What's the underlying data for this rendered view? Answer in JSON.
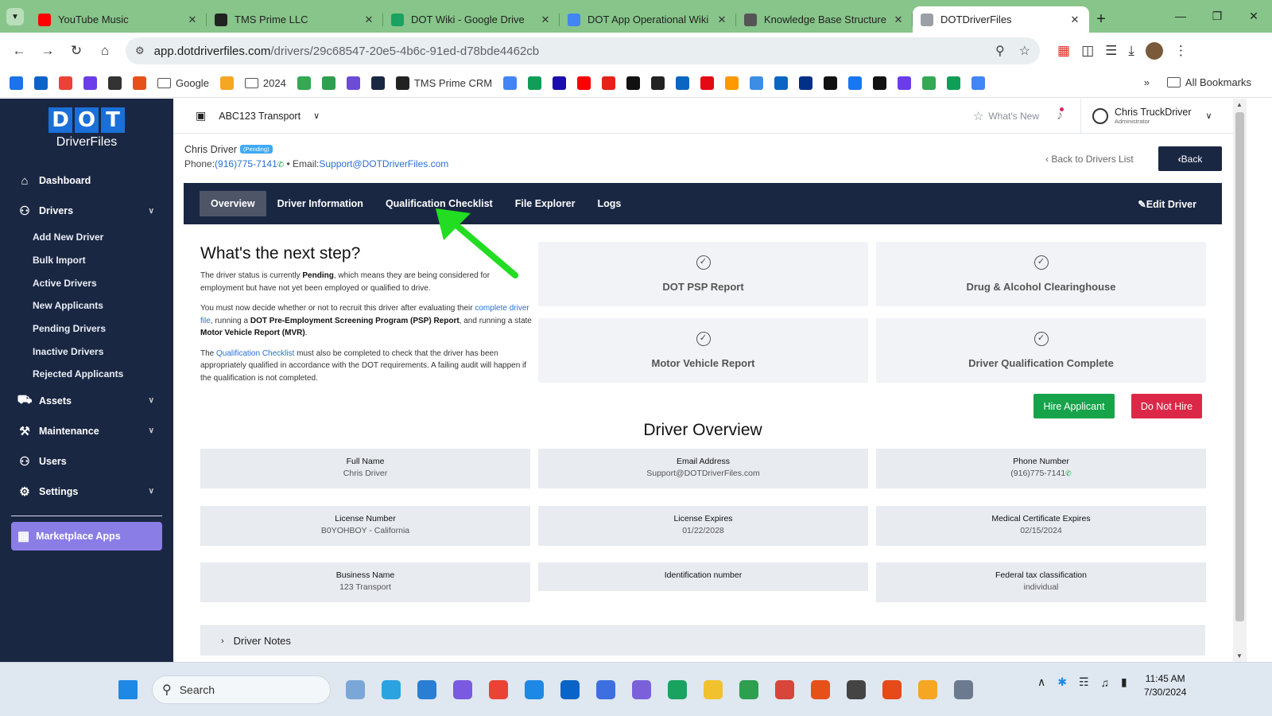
{
  "browser": {
    "tabs": [
      {
        "title": "YouTube Music",
        "color": "#ff0000"
      },
      {
        "title": "TMS Prime LLC",
        "color": "#222222"
      },
      {
        "title": "DOT Wiki - Google Drive",
        "color": "#1aa260"
      },
      {
        "title": "DOT App Operational Wiki",
        "color": "#4285f4"
      },
      {
        "title": "Knowledge Base Structure",
        "color": "#555555"
      },
      {
        "title": "DOTDriverFiles",
        "color": "#9aa0a6"
      }
    ],
    "url_host": "app.dotdriverfiles.com",
    "url_path": "/drivers/29c68547-20e5-4b6c-91ed-d78bde4462cb",
    "bookmarks": [
      {
        "label": "",
        "color": "#1a73e8"
      },
      {
        "label": "",
        "color": "#0a64c8"
      },
      {
        "label": "",
        "color": "#ea4335"
      },
      {
        "label": "",
        "color": "#6a3de8"
      },
      {
        "label": "",
        "color": "#333333"
      },
      {
        "label": "",
        "color": "#e8501a"
      },
      {
        "label": "Google",
        "folder": true
      },
      {
        "label": "",
        "color": "#f5a623"
      },
      {
        "label": "2024",
        "folder": true
      },
      {
        "label": "",
        "color": "#34a853"
      },
      {
        "label": "",
        "color": "#2e9e4f"
      },
      {
        "label": "",
        "color": "#6c4bd8"
      },
      {
        "label": "",
        "color": "#1a2743"
      },
      {
        "label": "TMS Prime CRM",
        "color": "#222222"
      },
      {
        "label": "",
        "color": "#4285f4"
      },
      {
        "label": "",
        "color": "#0f9d58"
      },
      {
        "label": "",
        "color": "#1a0dab"
      },
      {
        "label": "",
        "color": "#ff0000"
      },
      {
        "label": "",
        "color": "#e62117"
      },
      {
        "label": "",
        "color": "#111111"
      },
      {
        "label": "",
        "color": "#222222"
      },
      {
        "label": "",
        "color": "#0a66c2"
      },
      {
        "label": "",
        "color": "#e50914"
      },
      {
        "label": "",
        "color": "#ff9900"
      },
      {
        "label": "",
        "color": "#3d8de6"
      },
      {
        "label": "",
        "color": "#0a66c2"
      },
      {
        "label": "",
        "color": "#003087"
      },
      {
        "label": "",
        "color": "#111111"
      },
      {
        "label": "",
        "color": "#1877f2"
      },
      {
        "label": "",
        "color": "#111111"
      },
      {
        "label": "",
        "color": "#6a3de8"
      },
      {
        "label": "",
        "color": "#34a853"
      },
      {
        "label": "",
        "color": "#0f9d58"
      },
      {
        "label": "",
        "color": "#4285f4"
      }
    ],
    "all_bookmarks": "All Bookmarks"
  },
  "sidebar": {
    "logo_letters": [
      "D",
      "O",
      "T"
    ],
    "logo_sub": "DriverFiles",
    "items": [
      {
        "label": "Dashboard",
        "icon": "home-icon"
      },
      {
        "label": "Drivers",
        "icon": "users-icon",
        "expandable": true
      }
    ],
    "driver_sub": [
      "Add New Driver",
      "Bulk Import",
      "Active Drivers",
      "New Applicants",
      "Pending Drivers",
      "Inactive Drivers",
      "Rejected Applicants"
    ],
    "items2": [
      {
        "label": "Assets",
        "icon": "truck-icon",
        "expandable": true
      },
      {
        "label": "Maintenance",
        "icon": "wrench-icon",
        "expandable": true
      },
      {
        "label": "Users",
        "icon": "users-icon"
      },
      {
        "label": "Settings",
        "icon": "gear-icon",
        "expandable": true
      }
    ],
    "marketplace": "Marketplace Apps"
  },
  "topbar": {
    "company": "ABC123 Transport",
    "whats_new": "What's New",
    "user_name": "Chris TruckDriver",
    "user_role": "Administrator"
  },
  "driver": {
    "name": "Chris Driver",
    "status": "(Pending)",
    "phone_label": "Phone:",
    "phone": "(916)775-7141",
    "email_label": "• Email:",
    "email": "Support@DOTDriverFiles.com",
    "back_to_list": "Back to Drivers List",
    "back": "Back"
  },
  "tabs": [
    "Overview",
    "Driver Information",
    "Qualification Checklist",
    "File Explorer",
    "Logs"
  ],
  "edit_driver": "Edit Driver",
  "next_step": {
    "title": "What's the next step?",
    "p1_a": "The driver status is currently ",
    "p1_b": "Pending",
    "p1_c": ", which means they are being considered for employment but have not yet been employed or qualified to drive.",
    "p2_a": "You must now decide whether or not to recruit this driver after evaluating their ",
    "p2_link": "complete driver file",
    "p2_b": ", running a ",
    "p2_c": "DOT Pre-Employment Screening Program (PSP) Report",
    "p2_d": ", and running a state ",
    "p2_e": "Motor Vehicle Report (MVR)",
    "p2_f": ".",
    "p3_a": "The ",
    "p3_link": "Qualification Checklist",
    "p3_b": " must also be completed to check that the driver has been appropriately qualified in accordance with the DOT requirements. A failing audit will happen if the qualification is not completed."
  },
  "checks": [
    "DOT PSP Report",
    "Drug & Alcohol Clearinghouse",
    "Motor Vehicle Report",
    "Driver Qualification Complete"
  ],
  "hire": "Hire Applicant",
  "no_hire": "Do Not Hire",
  "overview": {
    "title": "Driver Overview",
    "fields": [
      {
        "k": "Full Name",
        "v": "Chris Driver"
      },
      {
        "k": "Email Address",
        "v": "Support@DOTDriverFiles.com"
      },
      {
        "k": "Phone Number",
        "v": "(916)775-7141"
      },
      {
        "k": "License Number",
        "v": "B0YOHBOY - California"
      },
      {
        "k": "License Expires",
        "v": "01/22/2028"
      },
      {
        "k": "Medical Certificate Expires",
        "v": "02/15/2024"
      },
      {
        "k": "Business Name",
        "v": "123 Transport"
      },
      {
        "k": "Identification number",
        "v": ""
      },
      {
        "k": "Federal tax classification",
        "v": "individual"
      }
    ]
  },
  "notes": "Driver Notes",
  "taskbar": {
    "search": "Search",
    "time": "11:45 AM",
    "date": "7/30/2024",
    "apps": [
      "#7aa7d8",
      "#2aa3e0",
      "#2a7fd4",
      "#7a5ae0",
      "#ea4335",
      "#1e88e5",
      "#0a64c8",
      "#3d6fe0",
      "#7b61d9",
      "#1aa260",
      "#f2c12e",
      "#2e9e4f",
      "#d8453a",
      "#e8501a",
      "#444444",
      "#e64a19",
      "#f5a623",
      "#6b7a8f"
    ]
  }
}
